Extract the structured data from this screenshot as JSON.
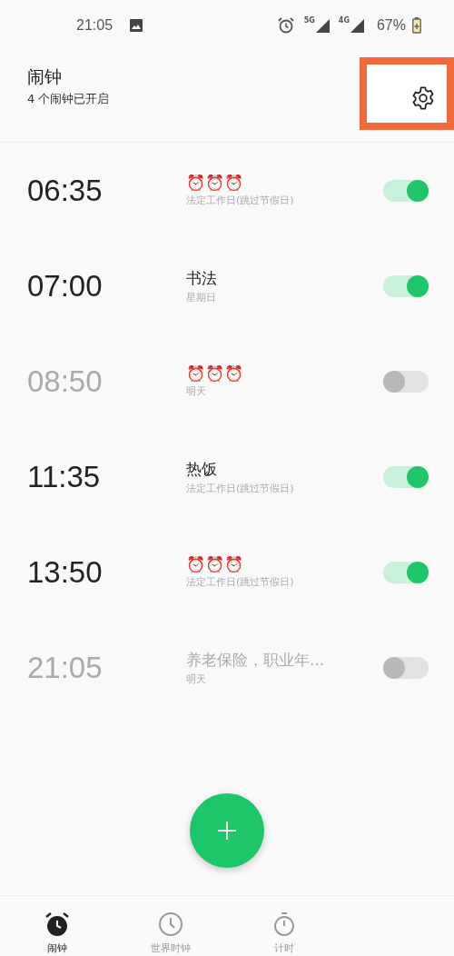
{
  "status_bar": {
    "time": "21:05",
    "network_5g": "5G",
    "network_4g": "4G",
    "battery": "67%"
  },
  "header": {
    "title": "闹钟",
    "subtitle": "4 个闹钟已开启",
    "settings_highlighted": true
  },
  "alarms": [
    {
      "time": "06:35",
      "label": "⏰⏰⏰",
      "repeat": "法定工作日(跳过节假日)",
      "on": true
    },
    {
      "time": "07:00",
      "label": "书法",
      "repeat": "星期日",
      "on": true
    },
    {
      "time": "08:50",
      "label": "⏰⏰⏰",
      "repeat": "明天",
      "on": false
    },
    {
      "time": "11:35",
      "label": "热饭",
      "repeat": "法定工作日(跳过节假日)",
      "on": true
    },
    {
      "time": "13:50",
      "label": "⏰⏰⏰",
      "repeat": "法定工作日(跳过节假日)",
      "on": true
    },
    {
      "time": "21:05",
      "label": "养老保险，职业年...",
      "repeat": "明天",
      "on": false
    }
  ],
  "bottom_nav": [
    {
      "label": "闹钟",
      "kind": "alarm",
      "selected": true
    },
    {
      "label": "世界时钟",
      "kind": "clock",
      "selected": false
    },
    {
      "label": "计时",
      "kind": "timer",
      "selected": false
    }
  ]
}
